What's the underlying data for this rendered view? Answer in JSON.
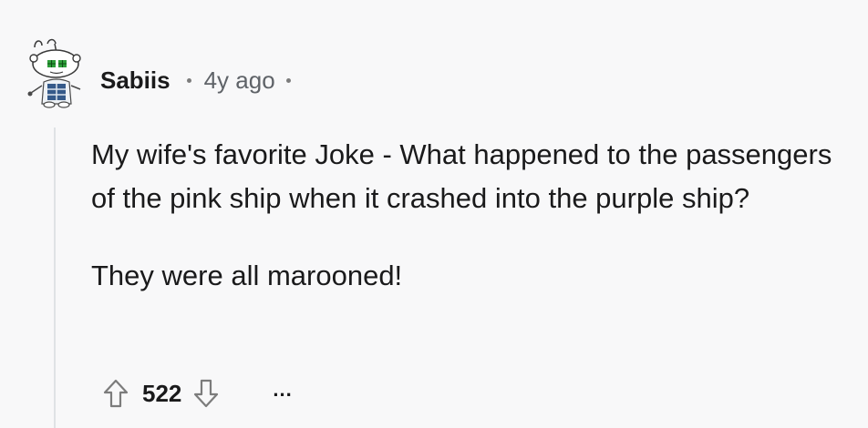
{
  "comment": {
    "username": "Sabiis",
    "timestamp": "4y ago",
    "paragraphs": [
      "My wife's favorite Joke - What happened to the passengers of the pink ship when it crashed into the purple ship?",
      "They were all marooned!"
    ],
    "score": "522",
    "more_label": "..."
  },
  "icons": {
    "avatar": "snoo-avatar-icon",
    "upvote": "upvote-arrow-icon",
    "downvote": "downvote-arrow-icon",
    "more": "more-options-icon"
  },
  "colors": {
    "background": "#f8f8f9",
    "text": "#1a1a1b",
    "meta": "#5f6368",
    "thread_line": "#dfe2e5",
    "avatar_eyes": "#2e9e3a"
  }
}
